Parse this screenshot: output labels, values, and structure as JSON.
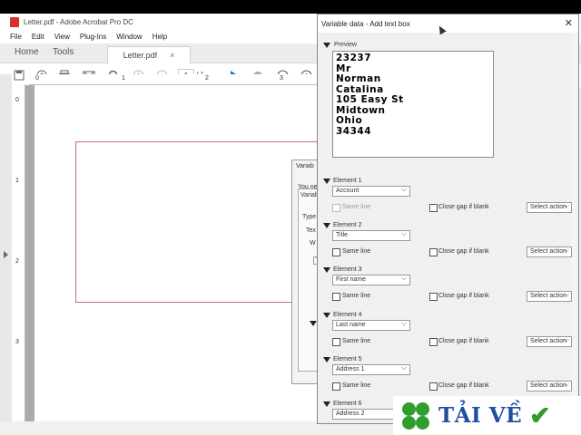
{
  "acrobat": {
    "title": "Letter.pdf - Adobe Acrobat Pro DC",
    "menu": [
      "File",
      "Edit",
      "View",
      "Plug-Ins",
      "Window",
      "Help"
    ],
    "tabs": {
      "home": "Home",
      "tools": "Tools",
      "document": "Letter.pdf",
      "close": "×"
    },
    "page_current": "1",
    "page_total": "/ 1",
    "ruler_h": [
      "0",
      "1",
      "2",
      "3"
    ],
    "ruler_v": [
      "0",
      "1",
      "2",
      "3"
    ],
    "behind_dialog": {
      "title": "Variab",
      "line1": "You ne",
      "sub_title": "Variab",
      "type": "Type",
      "text": "Tex",
      "w": "W",
      "t": "T"
    }
  },
  "dialog": {
    "title": "Variable data - Add text box",
    "close": "✕",
    "preview_label": "Preview",
    "preview_lines": [
      "23237",
      "Mr",
      "Norman",
      "Catalina",
      "105 Easy St",
      "Midtown",
      "Ohio",
      "34344"
    ],
    "same_line_label": "Same line",
    "close_gap_label": "Close gap if blank",
    "select_action_label": "Select action",
    "elements": [
      {
        "label": "Element 1",
        "value": "Account"
      },
      {
        "label": "Element 2",
        "value": "Title"
      },
      {
        "label": "Element 3",
        "value": "First name"
      },
      {
        "label": "Element 4",
        "value": "Last name"
      },
      {
        "label": "Element 5",
        "value": "Address 1"
      },
      {
        "label": "Element 6",
        "value": "Address 2"
      }
    ]
  },
  "logo": {
    "text": "TẢI VỀ",
    "check": "✔"
  },
  "colors": {
    "pdf_red": "#d9302c",
    "logo_blue": "#1f4ea3",
    "logo_green": "#2f9e2f"
  }
}
